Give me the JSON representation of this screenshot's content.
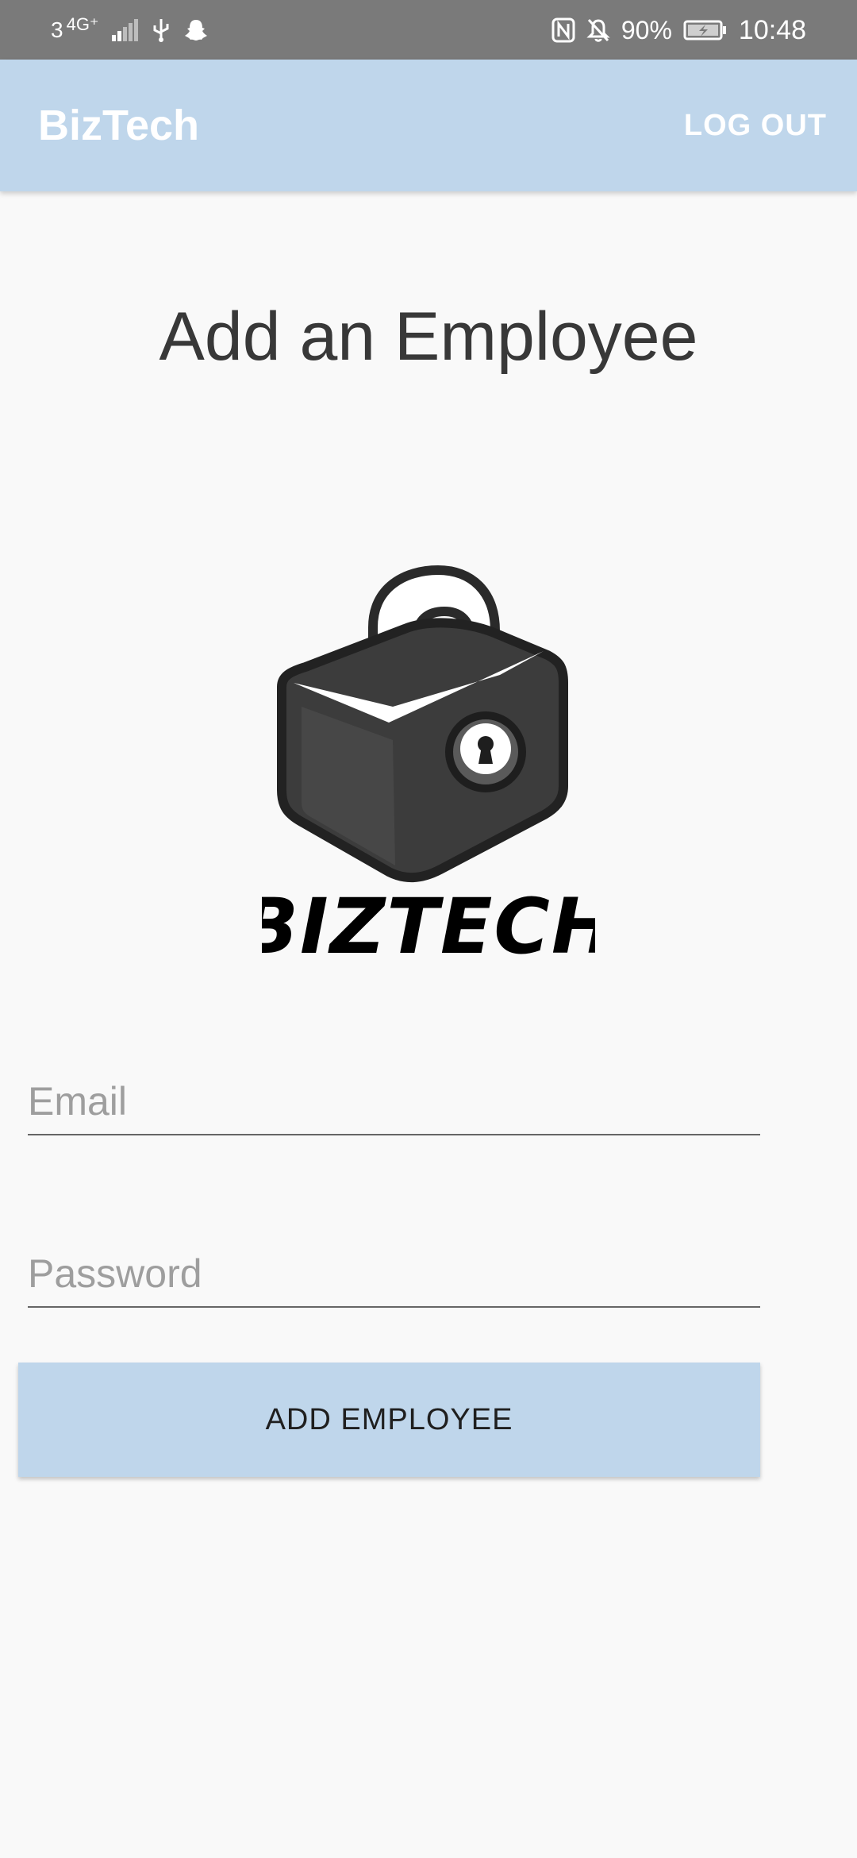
{
  "status_bar": {
    "carrier": "3",
    "network": "4G⁺",
    "battery_percent": "90%",
    "time": "10:48",
    "icons": [
      "signal-icon",
      "usb-icon",
      "snapchat-icon",
      "nfc-icon",
      "mute-icon",
      "battery-charging-icon"
    ]
  },
  "app_bar": {
    "title": "BizTech",
    "logout_label": "LOG OUT",
    "color": "#bfd6eb"
  },
  "page": {
    "title": "Add an Employee"
  },
  "logo": {
    "text": "BIZTECH"
  },
  "form": {
    "email_placeholder": "Email",
    "email_value": "",
    "password_placeholder": "Password",
    "password_value": "",
    "submit_label": "ADD EMPLOYEE"
  }
}
